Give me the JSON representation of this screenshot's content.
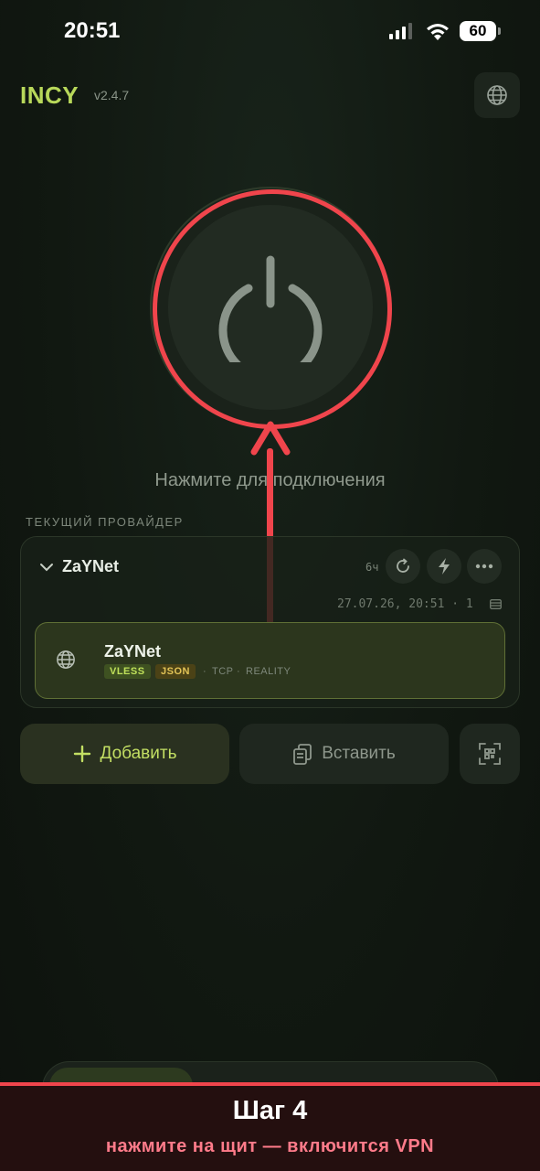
{
  "status_bar": {
    "time": "20:51",
    "battery": "60"
  },
  "header": {
    "app_name": "INCY",
    "version": "v2.4.7"
  },
  "power": {
    "hint": "Нажмите для подключения"
  },
  "provider_section": {
    "label": "ТЕКУЩИЙ ПРОВАЙДЕР",
    "provider": {
      "name": "ZaYNet",
      "interval": "6ч",
      "updated": "27.07.26, 20:51 · 1"
    }
  },
  "server": {
    "name": "ZaYNet",
    "tags": [
      "VLESS",
      "JSON"
    ],
    "transport": "TCP",
    "security": "REALITY"
  },
  "actions": {
    "add_label": "Добавить",
    "paste_label": "Вставить"
  },
  "banner": {
    "title": "Шаг 4",
    "subtitle": "нажмите на щит — включится VPN"
  },
  "colors": {
    "accent": "#b8d85a",
    "highlight": "#f0454c"
  }
}
